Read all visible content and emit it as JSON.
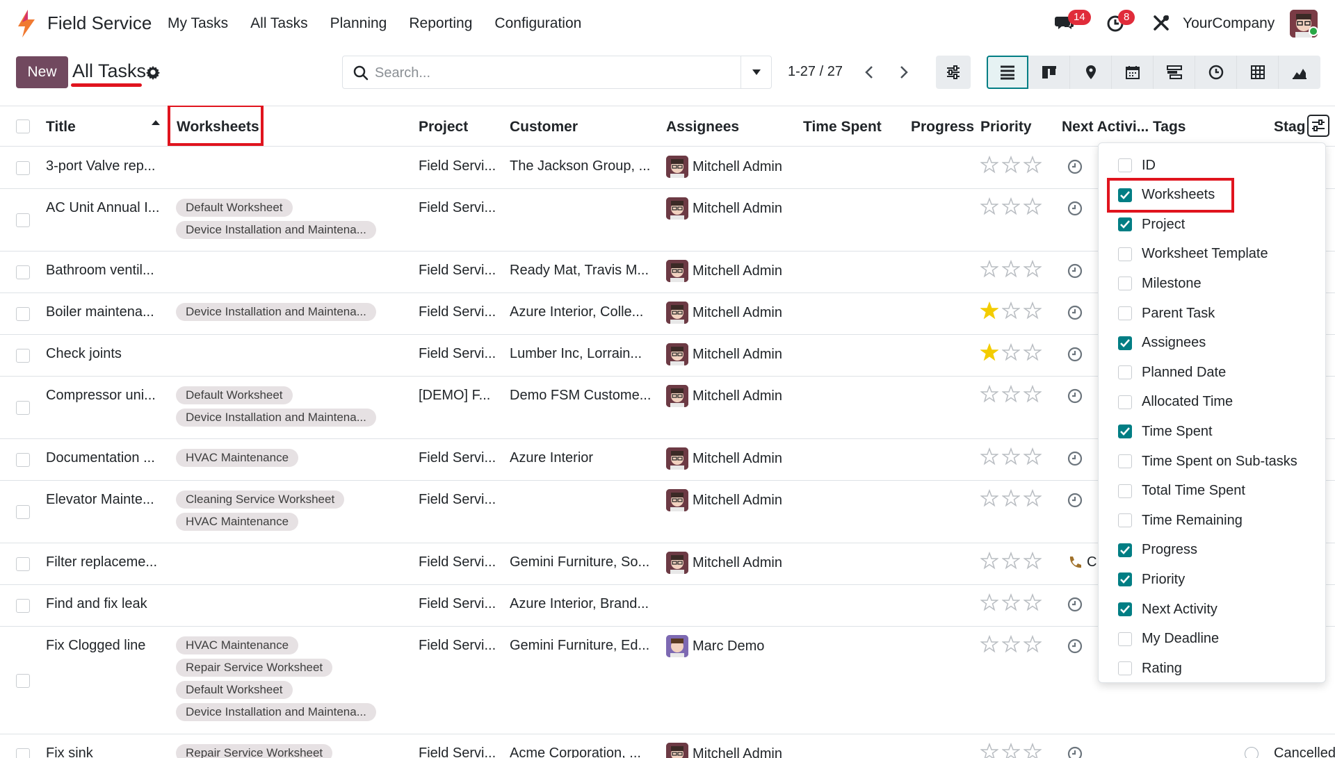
{
  "app": {
    "name": "Field Service",
    "menu": [
      "My Tasks",
      "All Tasks",
      "Planning",
      "Reporting",
      "Configuration"
    ],
    "messages_count": "14",
    "activities_count": "8",
    "company": "YourCompany"
  },
  "control": {
    "new_label": "New",
    "breadcrumb": "All Tasks",
    "search_placeholder": "Search...",
    "pager": "1-27 / 27"
  },
  "columns": {
    "title": "Title",
    "worksheets": "Worksheets",
    "project": "Project",
    "customer": "Customer",
    "assignees": "Assignees",
    "time_spent": "Time Spent",
    "progress": "Progress",
    "priority": "Priority",
    "next_activity": "Next Activi...",
    "tags": "Tags",
    "stage": "Stag"
  },
  "rows": [
    {
      "title": "3-port Valve rep...",
      "worksheets": [],
      "project": "Field Servi...",
      "customer": "The Jackson Group, ...",
      "assignee": "Mitchell Admin",
      "priority": 0
    },
    {
      "title": "AC Unit Annual I...",
      "worksheets": [
        "Default Worksheet",
        "Device Installation and Maintena..."
      ],
      "project": "Field Servi...",
      "customer": "",
      "assignee": "Mitchell Admin",
      "priority": 0
    },
    {
      "title": "Bathroom ventil...",
      "worksheets": [],
      "project": "Field Servi...",
      "customer": "Ready Mat, Travis M...",
      "assignee": "Mitchell Admin",
      "priority": 0
    },
    {
      "title": "Boiler maintena...",
      "worksheets": [
        "Device Installation and Maintena..."
      ],
      "project": "Field Servi...",
      "customer": "Azure Interior, Colle...",
      "assignee": "Mitchell Admin",
      "priority": 1
    },
    {
      "title": "Check joints",
      "worksheets": [],
      "project": "Field Servi...",
      "customer": "Lumber Inc, Lorrain...",
      "assignee": "Mitchell Admin",
      "priority": 1
    },
    {
      "title": "Compressor uni...",
      "worksheets": [
        "Default Worksheet",
        "Device Installation and Maintena..."
      ],
      "project": "[DEMO] F...",
      "customer": "Demo FSM Custome...",
      "assignee": "Mitchell Admin",
      "priority": 0
    },
    {
      "title": "Documentation ...",
      "worksheets": [
        "HVAC Maintenance"
      ],
      "project": "Field Servi...",
      "customer": "Azure Interior",
      "assignee": "Mitchell Admin",
      "priority": 0
    },
    {
      "title": "Elevator Mainte...",
      "worksheets": [
        "Cleaning Service Worksheet",
        "HVAC Maintenance"
      ],
      "project": "Field Servi...",
      "customer": "",
      "assignee": "Mitchell Admin",
      "priority": 0
    },
    {
      "title": "Filter replaceme...",
      "worksheets": [],
      "project": "Field Servi...",
      "customer": "Gemini Furniture, So...",
      "assignee": "Mitchell Admin",
      "priority": 0,
      "activity_text": "C"
    },
    {
      "title": "Find and fix leak",
      "worksheets": [],
      "project": "Field Servi...",
      "customer": "Azure Interior, Brand...",
      "assignee": "",
      "priority": 0
    },
    {
      "title": "Fix Clogged line",
      "worksheets": [
        "HVAC Maintenance",
        "Repair Service Worksheet",
        "Default Worksheet",
        "Device Installation and Maintena..."
      ],
      "project": "Field Servi...",
      "customer": "Gemini Furniture, Ed...",
      "assignee": "Marc Demo",
      "priority": 0
    },
    {
      "title": "Fix sink",
      "worksheets": [
        "Repair Service Worksheet"
      ],
      "project": "Field Servi...",
      "customer": "Acme Corporation, ...",
      "assignee": "Mitchell Admin",
      "priority": 0,
      "stage": "Cancelled"
    }
  ],
  "optional_columns": [
    {
      "label": "ID",
      "checked": false
    },
    {
      "label": "Worksheets",
      "checked": true
    },
    {
      "label": "Project",
      "checked": true
    },
    {
      "label": "Worksheet Template",
      "checked": false
    },
    {
      "label": "Milestone",
      "checked": false
    },
    {
      "label": "Parent Task",
      "checked": false
    },
    {
      "label": "Assignees",
      "checked": true
    },
    {
      "label": "Planned Date",
      "checked": false
    },
    {
      "label": "Allocated Time",
      "checked": false
    },
    {
      "label": "Time Spent",
      "checked": true
    },
    {
      "label": "Time Spent on Sub-tasks",
      "checked": false
    },
    {
      "label": "Total Time Spent",
      "checked": false
    },
    {
      "label": "Time Remaining",
      "checked": false
    },
    {
      "label": "Progress",
      "checked": true
    },
    {
      "label": "Priority",
      "checked": true
    },
    {
      "label": "Next Activity",
      "checked": true
    },
    {
      "label": "My Deadline",
      "checked": false
    },
    {
      "label": "Rating",
      "checked": false
    }
  ],
  "colors": {
    "brand": "#71495f",
    "accent": "#017e84",
    "highlight": "#e0141e",
    "star": "#f3cc00"
  }
}
